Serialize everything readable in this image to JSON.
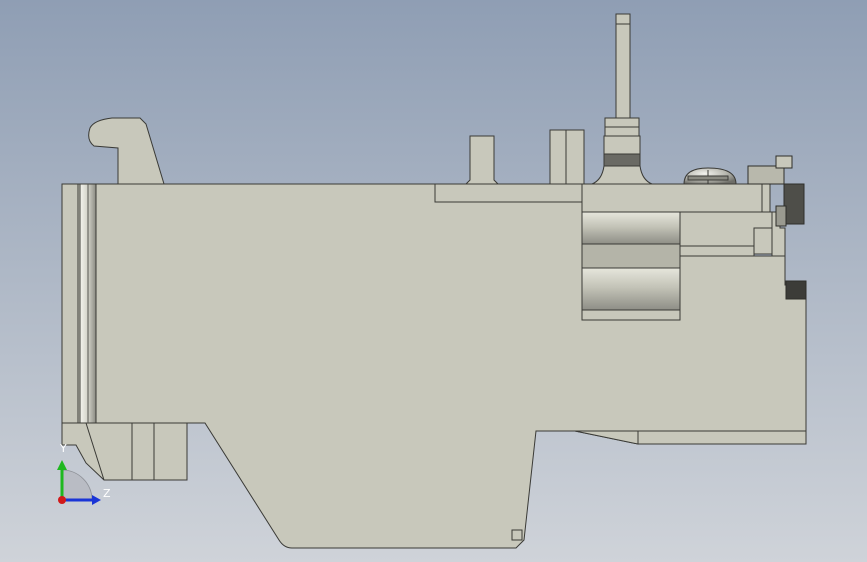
{
  "viewport": {
    "background_top": "#8f9eb4",
    "background_bottom": "#cfd3d9"
  },
  "part": {
    "body_color": "#c8c8bb",
    "edge_color": "#3a3a36",
    "shade_color": "#9c9c92",
    "dark_color": "#5a5a55"
  },
  "triad": {
    "y_label": "Y",
    "z_label": "Z",
    "y_color": "#1fb81f",
    "z_color": "#1a35d6",
    "x_color": "#d11a1a"
  }
}
